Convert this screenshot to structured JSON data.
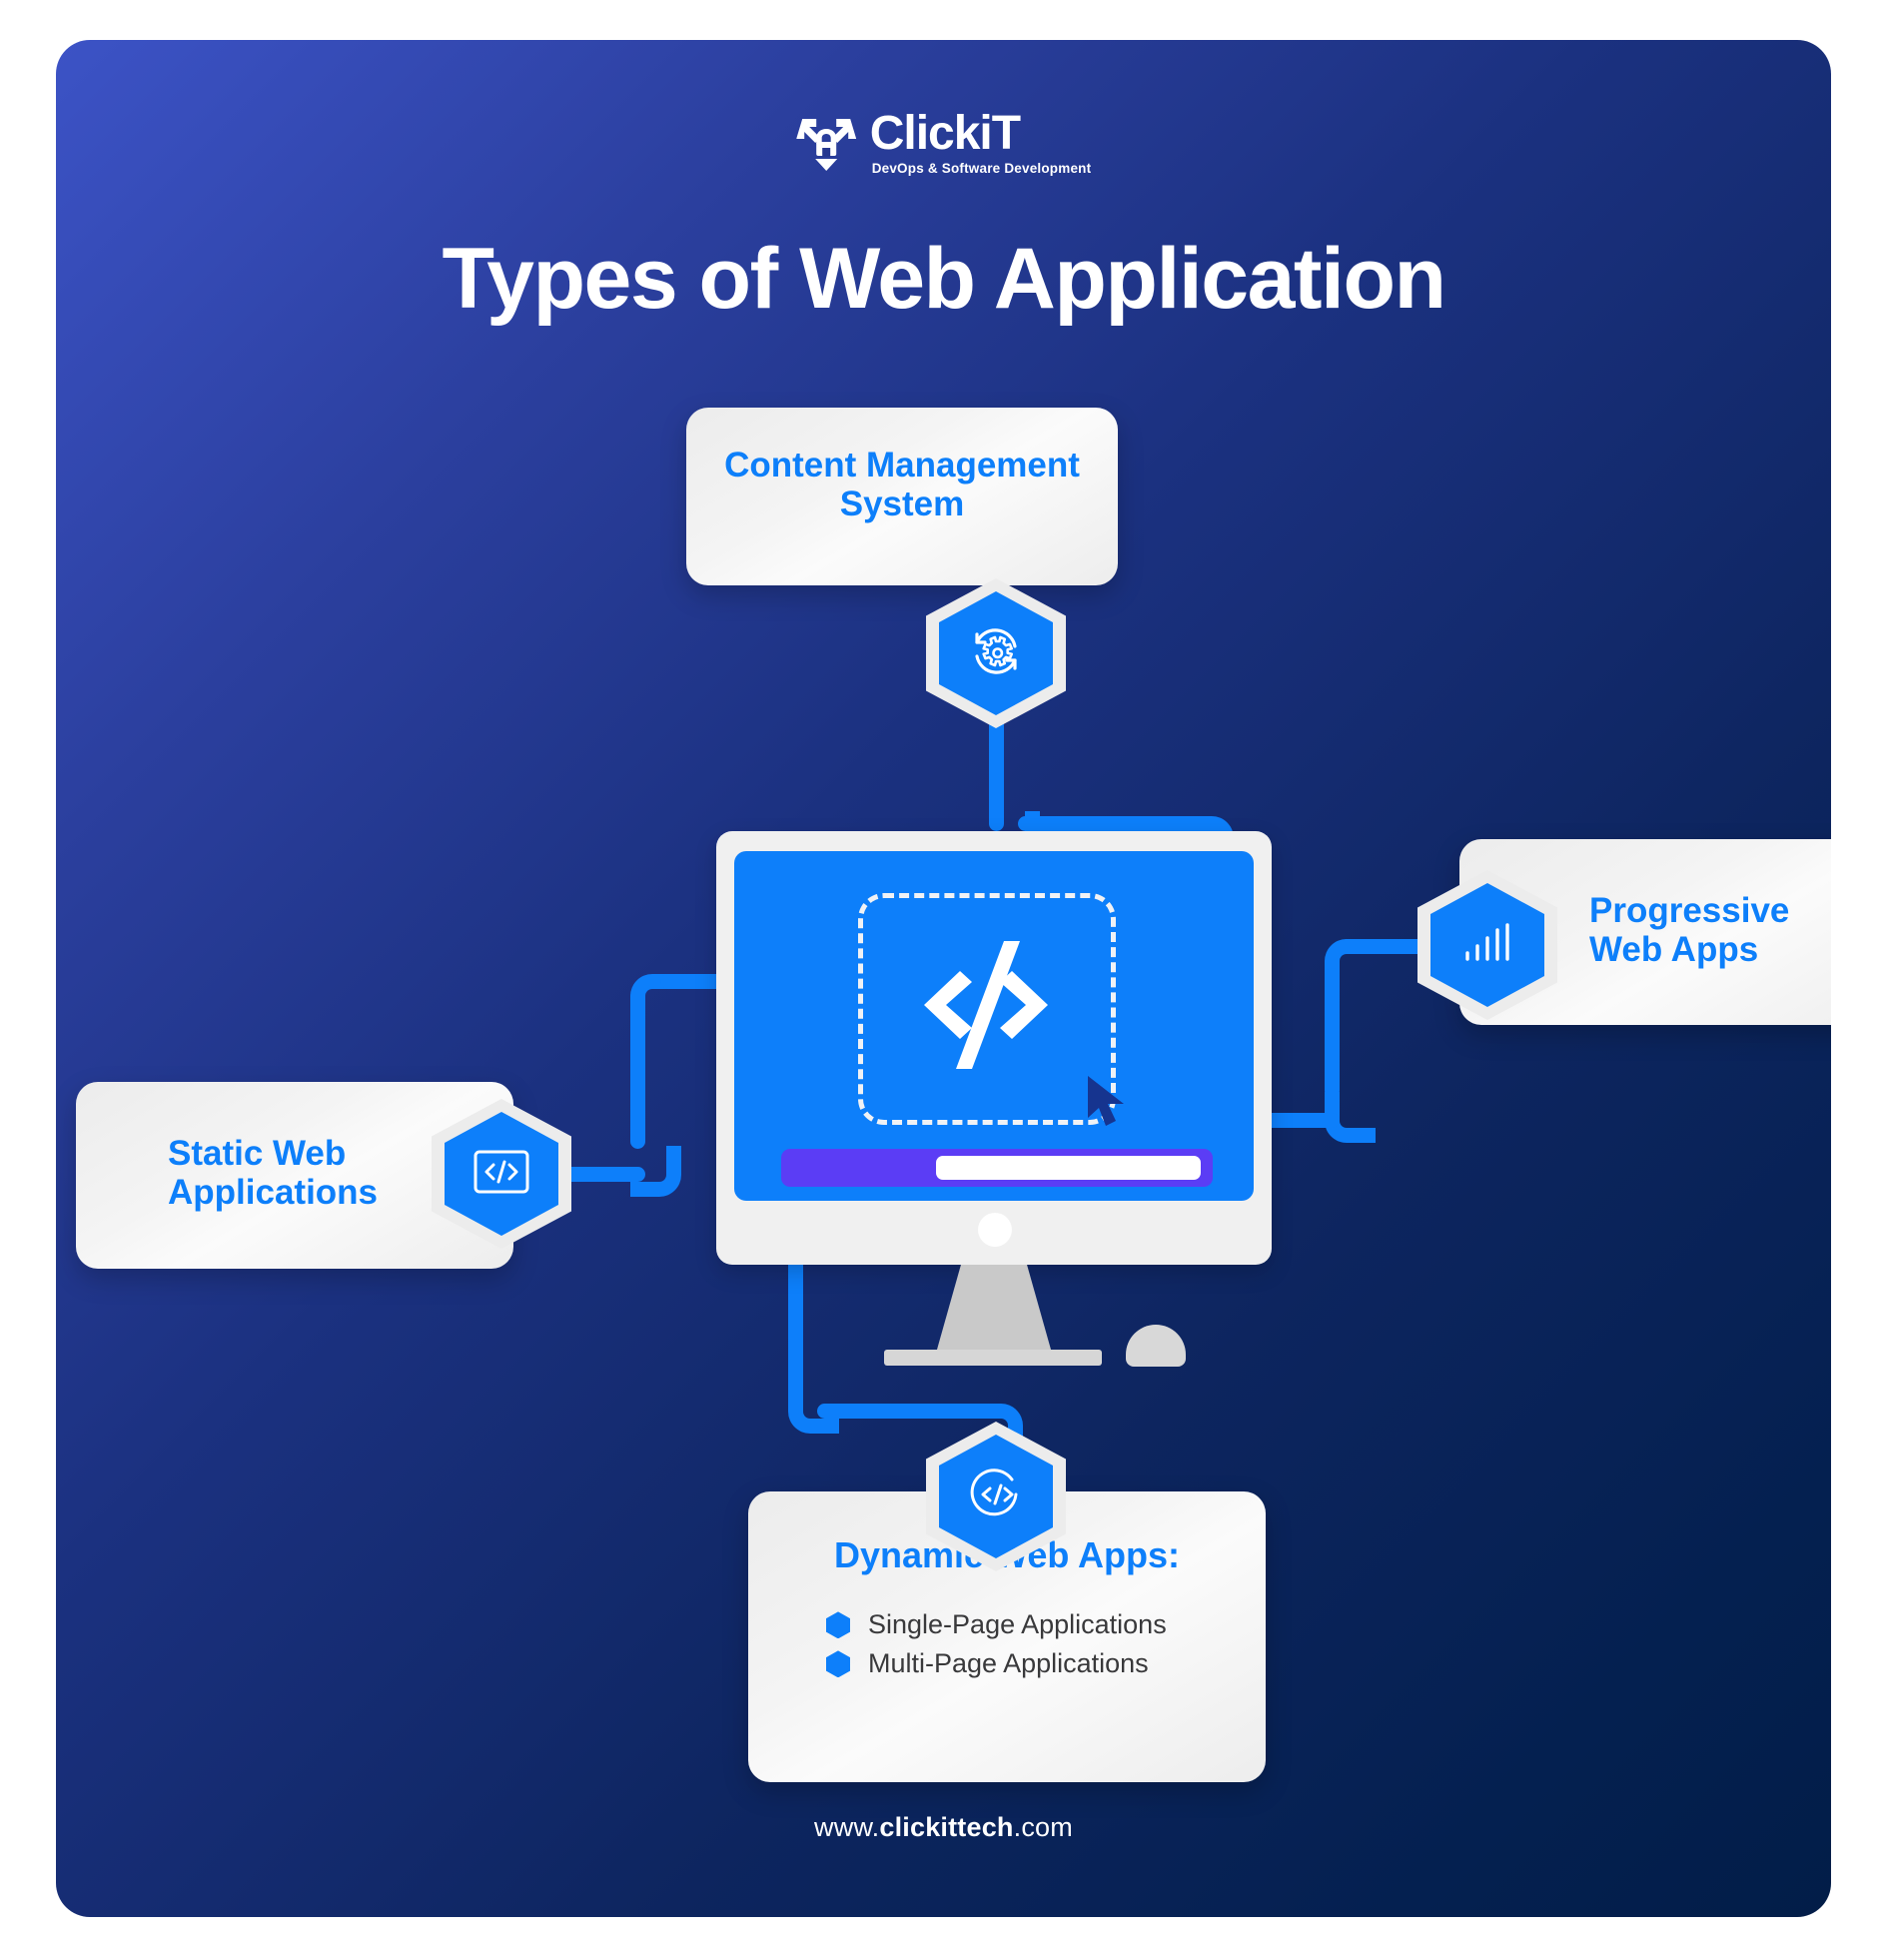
{
  "brand": {
    "logo_icon": "shield-lock-arrows-icon",
    "name": "ClickiT",
    "tagline": "DevOps & Software Development"
  },
  "header": {
    "title": "Types of Web Application"
  },
  "footer": {
    "prefix": "www.",
    "bold": "clickittech",
    "suffix": ".com"
  },
  "colors": {
    "accent_blue": "#0d7ffa",
    "purple_bar": "#5b3df5",
    "bg_start": "#3c53c6",
    "bg_end": "#021d48",
    "card_bg": "#f1f1f1",
    "bullet_text": "#39393b",
    "cursor": "#16348f"
  },
  "center": {
    "name": "desktop-monitor-illustration",
    "screen_icon": "code-brackets-icon",
    "cursor_icon": "mouse-pointer-icon",
    "peripheral_icon": "computer-mouse-icon"
  },
  "nodes": [
    {
      "id": "cms",
      "label": "Content Management System",
      "icon": "sync-gear-icon",
      "position": "top"
    },
    {
      "id": "static",
      "label": "Static Web\nApplications",
      "line1": "Static Web",
      "line2": "Applications",
      "icon": "code-window-icon",
      "position": "left"
    },
    {
      "id": "pwa",
      "label": "Progressive Web Apps",
      "line1": "Progressive",
      "line2": "Web Apps",
      "icon": "signal-bars-icon",
      "position": "right"
    },
    {
      "id": "dynamic",
      "label": "Dynamic Web Apps:",
      "icon": "code-circle-icon",
      "position": "bottom",
      "items": [
        "Single-Page Applications",
        "Multi-Page Applications"
      ]
    }
  ]
}
